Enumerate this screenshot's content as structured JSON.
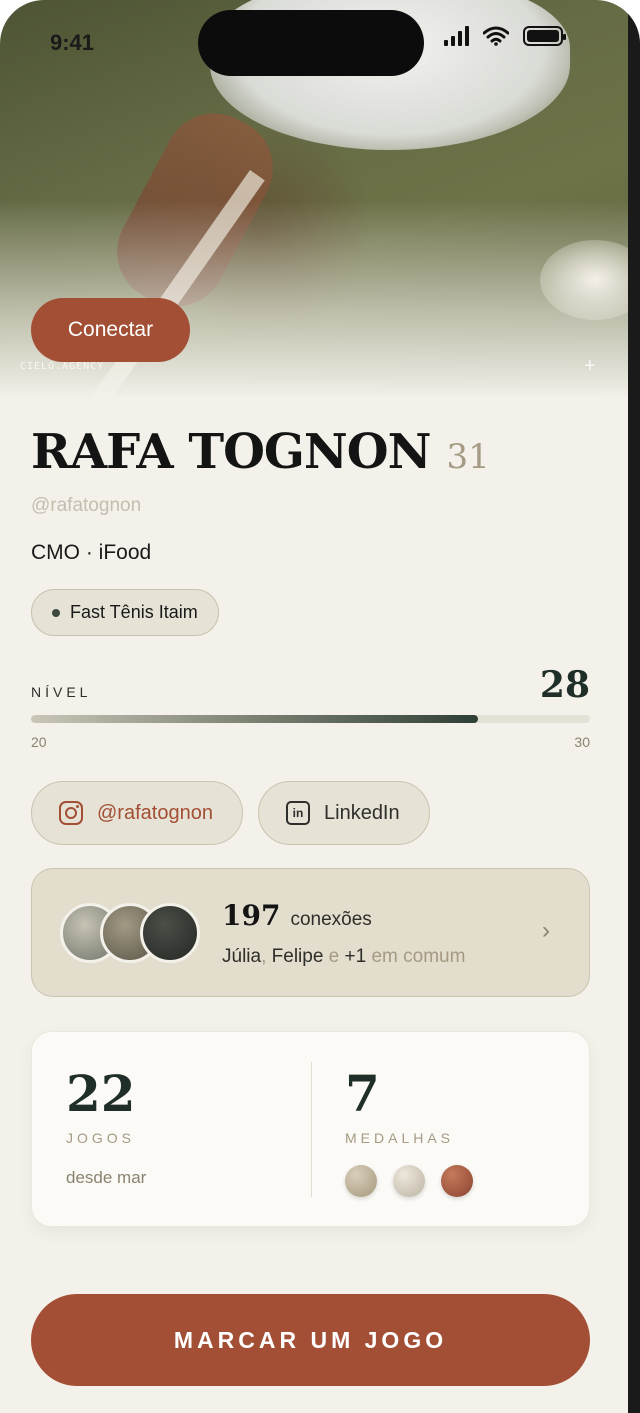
{
  "status_bar": {
    "time": "9:41"
  },
  "hero": {
    "connect_label": "Conectar",
    "watermark": "CIELO.AGENCY",
    "plus": "+"
  },
  "profile": {
    "name": "RAFA TOGNON",
    "age": "31",
    "handle": "@rafatognon",
    "role": "CMO · iFood",
    "club": "Fast Tênis Itaim"
  },
  "level": {
    "label": "NÍVEL",
    "value": "28",
    "min": "20",
    "max": "30",
    "progress_fraction": 0.8
  },
  "social": {
    "instagram": "@rafatognon",
    "linkedin": "LinkedIn"
  },
  "connections": {
    "count": "197",
    "label": "conexões",
    "mutual_name1": "Júlia",
    "sep1": ", ",
    "mutual_name2": "Felipe",
    "sep2": " e ",
    "mutual_extra": "+1",
    "suffix": " em comum"
  },
  "stats": {
    "games_value": "22",
    "games_label": "JOGOS",
    "games_since": "desde mar",
    "medals_value": "7",
    "medals_label": "MEDALHAS"
  },
  "cta": {
    "label": "MARCAR UM JOGO"
  },
  "colors": {
    "accent": "#a34f35",
    "background": "#f3f1ea",
    "dark_green": "#1f2e28"
  }
}
